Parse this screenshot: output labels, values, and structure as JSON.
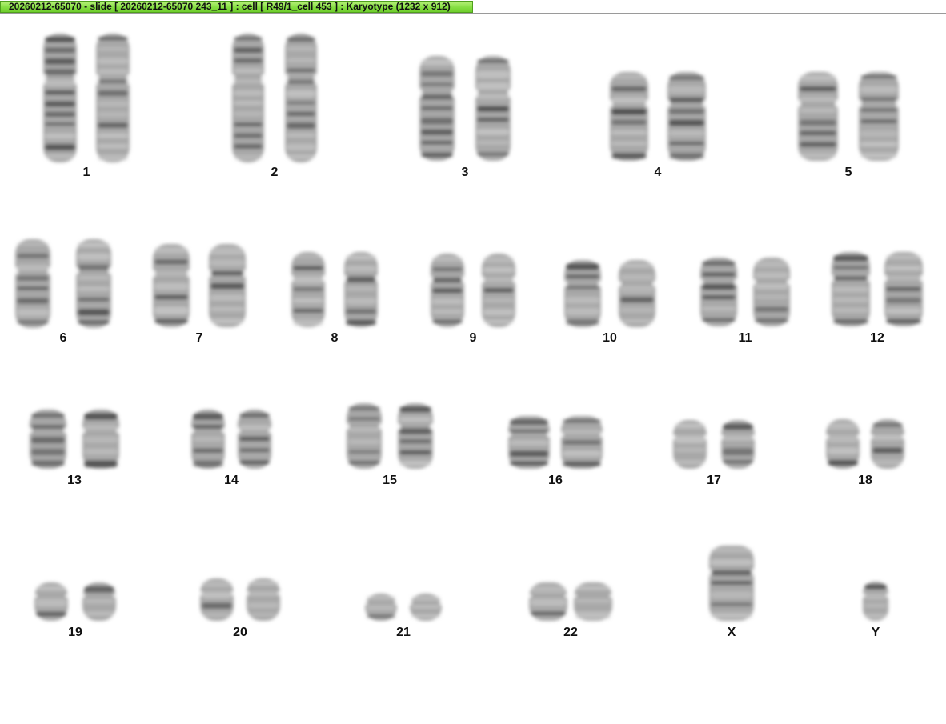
{
  "window": {
    "title": "20260212-65070 - slide [ 20260212-65070 243_11 ] : cell [ R49/1_cell 453 ] : Karyotype  (1232 x 912)"
  },
  "karyotype": {
    "chromosomes": [
      {
        "label": "1",
        "count": 2
      },
      {
        "label": "2",
        "count": 2
      },
      {
        "label": "3",
        "count": 2
      },
      {
        "label": "4",
        "count": 2
      },
      {
        "label": "5",
        "count": 2
      },
      {
        "label": "6",
        "count": 2
      },
      {
        "label": "7",
        "count": 2
      },
      {
        "label": "8",
        "count": 2
      },
      {
        "label": "9",
        "count": 2
      },
      {
        "label": "10",
        "count": 2
      },
      {
        "label": "11",
        "count": 2
      },
      {
        "label": "12",
        "count": 2
      },
      {
        "label": "13",
        "count": 2
      },
      {
        "label": "14",
        "count": 2
      },
      {
        "label": "15",
        "count": 2
      },
      {
        "label": "16",
        "count": 2
      },
      {
        "label": "17",
        "count": 2
      },
      {
        "label": "18",
        "count": 2
      },
      {
        "label": "19",
        "count": 2
      },
      {
        "label": "20",
        "count": 2
      },
      {
        "label": "21",
        "count": 2
      },
      {
        "label": "22",
        "count": 2
      },
      {
        "label": "X",
        "count": 1
      },
      {
        "label": "Y",
        "count": 1
      }
    ]
  }
}
